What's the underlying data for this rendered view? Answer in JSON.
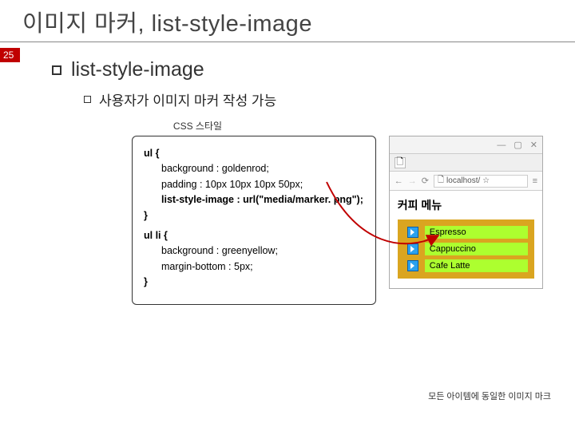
{
  "title": "이미지 마커, list-style-image",
  "page_number": "25",
  "heading": "list-style-image",
  "subheading": "사용자가 이미지 마커 작성 가능",
  "css_label": "CSS 스타일",
  "code": {
    "rule1_selector": "ul {",
    "rule1_decl1": "background : goldenrod;",
    "rule1_decl2": "padding : 10px 10px 10px 50px;",
    "rule1_decl3": "list-style-image : url(\"media/marker. png\");",
    "rule1_close": "}",
    "rule2_selector": "ul li {",
    "rule2_decl1": "background : greenyellow;",
    "rule2_decl2": "margin-bottom : 5px;",
    "rule2_close": "}"
  },
  "browser": {
    "url": "localhost/ ☆",
    "heading": "커피 메뉴",
    "items": [
      "Espresso",
      "Cappuccino",
      "Cafe Latte"
    ]
  },
  "footnote": "모든 아이템에 동일한 이미지 마크",
  "win_controls": {
    "min": "—",
    "max": "▢",
    "close": "✕"
  }
}
